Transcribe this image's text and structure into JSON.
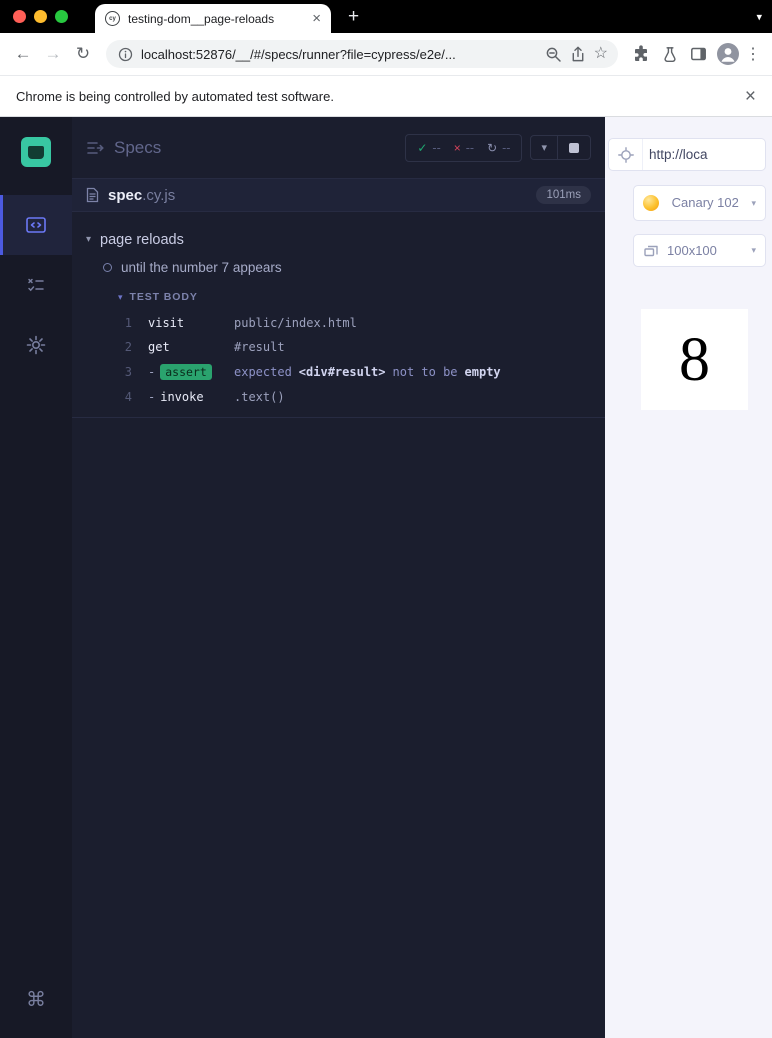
{
  "icons": {
    "check": "✓",
    "cross": "×",
    "refresh": "↻",
    "chevron_down": "▾",
    "back": "←",
    "forward": "→",
    "reload": "↻",
    "star": "☆",
    "dots": "⋮",
    "plus": "+",
    "command": "⌘",
    "close": "×"
  },
  "chrome": {
    "tab_title": "testing-dom__page-reloads",
    "favicon_text": "cy",
    "url": "localhost:52876/__/#/specs/runner?file=cypress/e2e/...",
    "infobar_message": "Chrome is being controlled by automated test software."
  },
  "reporter": {
    "title": "Specs",
    "stats": [
      "--",
      "--",
      "--"
    ],
    "spec_name": "spec",
    "spec_ext": ".cy.js",
    "spec_duration": "101ms",
    "suite_title": "page reloads",
    "test_title": "until the number 7 appears",
    "section_label": "TEST BODY",
    "commands": [
      {
        "num": "1",
        "name": "visit",
        "detail": "public/index.html"
      },
      {
        "num": "2",
        "name": "get",
        "detail": "#result"
      },
      {
        "num": "3",
        "dash": "-",
        "name": "assert",
        "d1": "expected",
        "d2": "<div#result>",
        "d3": "not to be",
        "d4": "empty"
      },
      {
        "num": "4",
        "dash": "-",
        "name": "invoke",
        "detail": ".text()"
      }
    ]
  },
  "aut": {
    "url_value": "http://loca",
    "browser_label": "Canary 102",
    "viewport_label": "100x100",
    "content_number": "8"
  }
}
